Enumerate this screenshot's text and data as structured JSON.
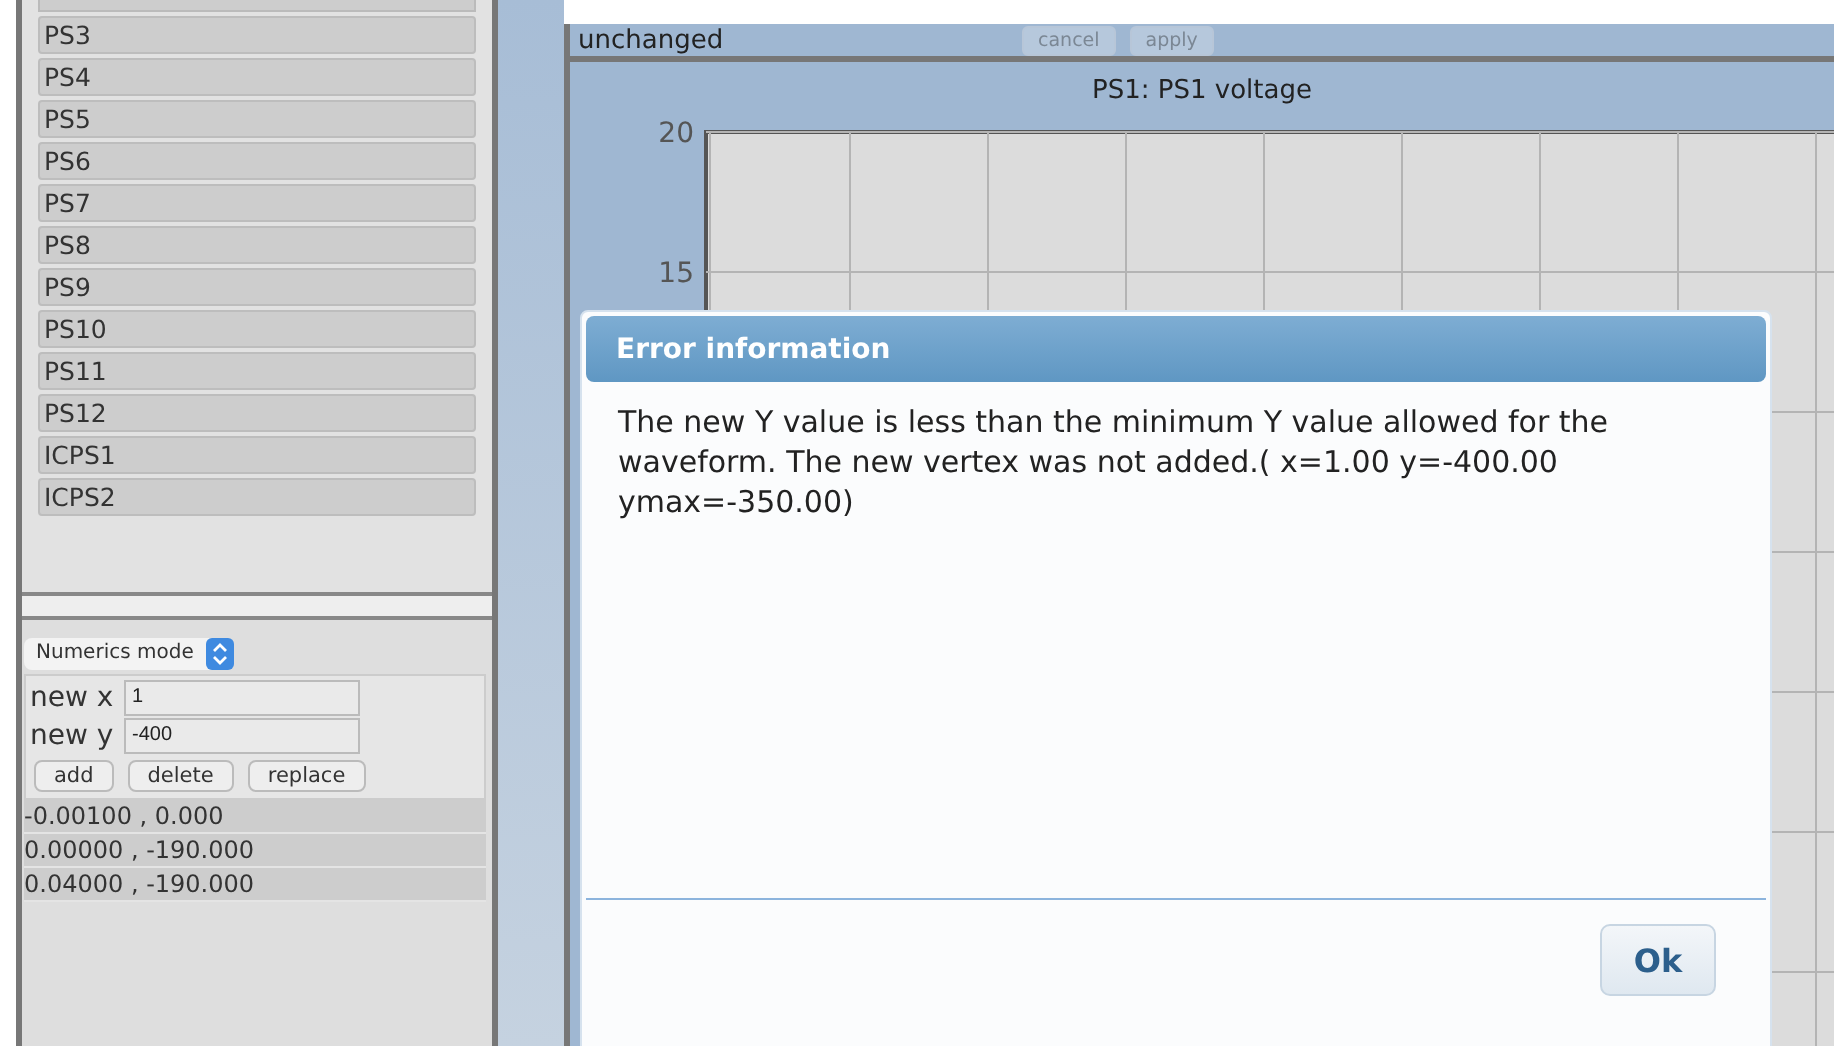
{
  "channel_list": {
    "items": [
      {
        "label": "PS3",
        "selected": false
      },
      {
        "label": "PS4",
        "selected": false
      },
      {
        "label": "PS5",
        "selected": false
      },
      {
        "label": "PS6",
        "selected": false
      },
      {
        "label": "PS7",
        "selected": false
      },
      {
        "label": "PS8",
        "selected": false
      },
      {
        "label": "PS9",
        "selected": false
      },
      {
        "label": "PS10",
        "selected": false
      },
      {
        "label": "PS11",
        "selected": false
      },
      {
        "label": "PS12",
        "selected": false
      },
      {
        "label": "ICPS1",
        "selected": false
      },
      {
        "label": "ICPS2",
        "selected": false
      }
    ]
  },
  "editor": {
    "mode_select": "Numerics mode",
    "fields": [
      {
        "label": "new x",
        "value": "1"
      },
      {
        "label": "new y",
        "value": "-400"
      }
    ],
    "buttons": [
      "add",
      "delete",
      "replace"
    ],
    "points": [
      "-0.00100 , 0.000",
      "0.00000 , -190.000",
      "0.04000 , -190.000"
    ]
  },
  "toolbar": {
    "status": "unchanged",
    "buttons": [
      {
        "label": "cancel",
        "disabled": true
      },
      {
        "label": "apply",
        "disabled": true
      }
    ]
  },
  "chart": {
    "title": "PS1: PS1 voltage",
    "y_ticks": [
      "20",
      "15"
    ]
  },
  "dialog": {
    "title": "Error information",
    "message": "The new Y value is less than the minimum Y value allowed for the waveform. The new vertex was not added.( x=1.00 y=-400.00 ymax=-350.00)",
    "button": "Ok"
  }
}
